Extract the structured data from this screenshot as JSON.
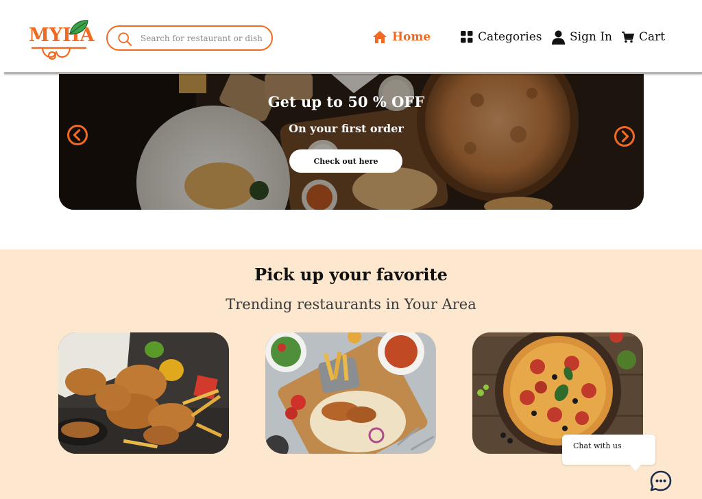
{
  "brand": {
    "logo_text": "MYHA",
    "accent_color": "#f26a21",
    "leaf_color": "#3aa34a"
  },
  "search": {
    "placeholder": "Search for restaurant or dish",
    "value": "",
    "icon": "search-icon"
  },
  "nav": {
    "items": [
      {
        "label": "Home",
        "icon": "home-icon",
        "active": true
      },
      {
        "label": "Categories",
        "icon": "grid-icon",
        "active": false
      },
      {
        "label": "Sign In",
        "icon": "user-icon",
        "active": false
      },
      {
        "label": "Cart",
        "icon": "cart-icon",
        "active": false
      }
    ]
  },
  "hero": {
    "title": "Get up to 50 % OFF",
    "subtitle": "On your first order",
    "cta_label": "Check out here",
    "prev_icon": "chevron-left-icon",
    "next_icon": "chevron-right-icon"
  },
  "trending": {
    "title": "Pick up your favorite",
    "subtitle": "Trending restaurants in Your Area",
    "background_color": "#fde8cf",
    "cards": [
      {
        "image": "fried-chicken-image"
      },
      {
        "image": "grilled-chicken-platter-image"
      },
      {
        "image": "pizza-image"
      }
    ]
  },
  "chat": {
    "label": "Chat with us",
    "icon": "chat-icon"
  }
}
